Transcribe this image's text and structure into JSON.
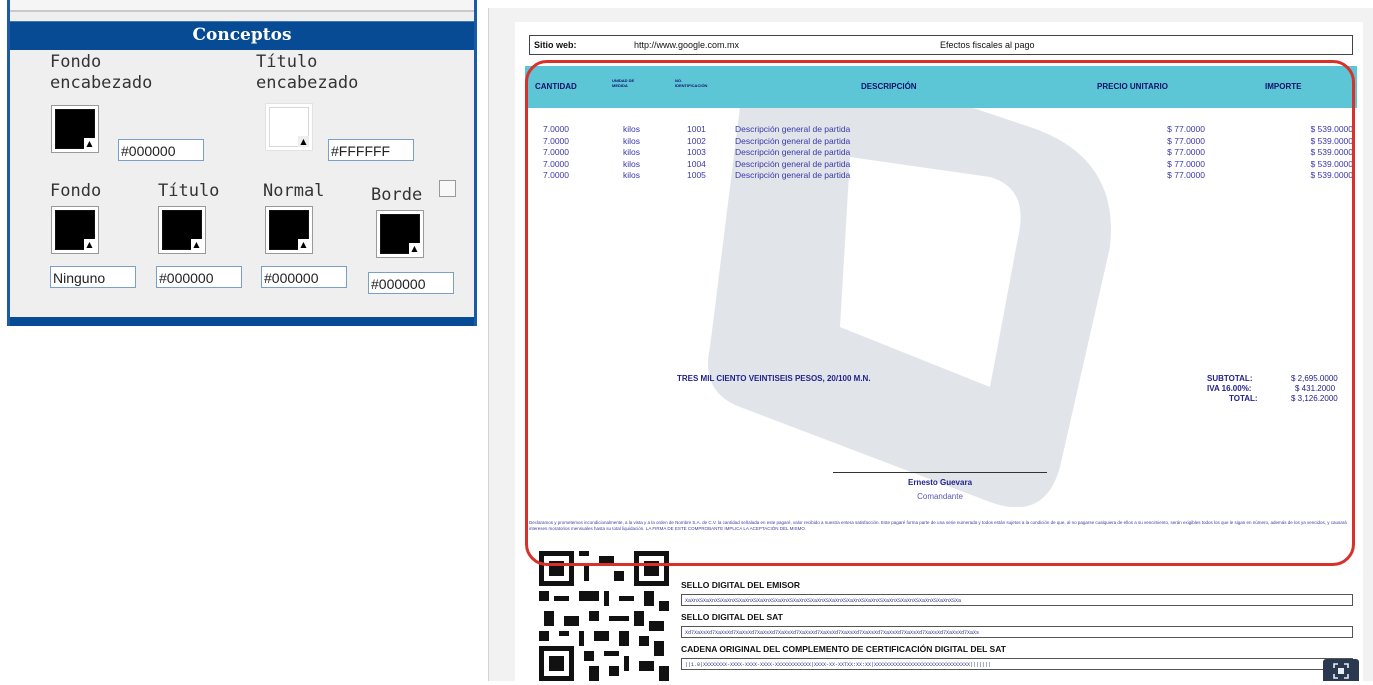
{
  "panel": {
    "header": "Conceptos",
    "fondo_encabezado": {
      "label": "Fondo\nencabezado",
      "value": "#000000",
      "color": "#000000"
    },
    "titulo_encabezado": {
      "label": "Título\nencabezado",
      "value": "#FFFFFF",
      "color": "#FFFFFF"
    },
    "fondo": {
      "label": "Fondo",
      "value": "Ninguno",
      "color": "#000000"
    },
    "titulo": {
      "label": "Título",
      "value": "#000000",
      "color": "#000000"
    },
    "normal": {
      "label": "Normal",
      "value": "#000000",
      "color": "#000000"
    },
    "borde": {
      "label": "Borde",
      "value": "#000000",
      "color": "#000000",
      "checked": false
    }
  },
  "invoice": {
    "site_label": "Sitio web:",
    "site_url": "http://www.google.com.mx",
    "site_note": "Efectos fiscales al pago",
    "columns": {
      "cantidad": "CANTIDAD",
      "unidad": "UNIDAD DE MEDIDA",
      "no": "NO. IDENTIFICACIÓN",
      "descripcion": "DESCRIPCIÓN",
      "precio": "PRECIO UNITARIO",
      "importe": "IMPORTE"
    },
    "rows": [
      {
        "cantidad": "7.0000",
        "unidad": "kilos",
        "no": "1001",
        "descripcion": "Descripción general de partida",
        "precio": "$ 77.0000",
        "importe": "$ 539.0000"
      },
      {
        "cantidad": "7.0000",
        "unidad": "kilos",
        "no": "1002",
        "descripcion": "Descripción general de partida",
        "precio": "$ 77.0000",
        "importe": "$ 539.0000"
      },
      {
        "cantidad": "7.0000",
        "unidad": "kilos",
        "no": "1003",
        "descripcion": "Descripción general de partida",
        "precio": "$ 77.0000",
        "importe": "$ 539.0000"
      },
      {
        "cantidad": "7.0000",
        "unidad": "kilos",
        "no": "1004",
        "descripcion": "Descripción general de partida",
        "precio": "$ 77.0000",
        "importe": "$ 539.0000"
      },
      {
        "cantidad": "7.0000",
        "unidad": "kilos",
        "no": "1005",
        "descripcion": "Descripción general de partida",
        "precio": "$ 77.0000",
        "importe": "$ 539.0000"
      }
    ],
    "amount_words": "TRES MIL CIENTO VEINTISEIS PESOS, 20/100 M.N.",
    "subtotal_label": "SUBTOTAL:",
    "subtotal": "$ 2,695.0000",
    "iva_label": "IVA 16.00%:",
    "iva": "$ 431.2000",
    "total_label": "TOTAL:",
    "total": "$ 3,126.2000",
    "signer_name": "Ernesto Guevara",
    "signer_role": "Comandante",
    "legal_text": "Declaramos y prometemos incondicionalmente, a la vista y a la orden de Nombre S.A. de C.V. la cantidad señalada en este pagaré, valor recibido a nuestra entera satisfacción. Este pagaré forma parte de una serie numerada y todos están sujetos a la condición de que, al no pagarse cualquiera de ellos a su vencimiento, serán exigibles todos los que le sigan en número, además de los ya vencidos, y causará intereses moratorios mensuales hasta su total liquidación. LA FIRMA DE ESTE COMPROBANTE IMPLICA LA ACEPTACIÓN DEL MISMO.",
    "sello_emisor_label": "SELLO DIGITAL DEL EMISOR",
    "sello_emisor": "XaXnXSXaXnXSXaXnXSXaXnXSXaXnXSXaXnXSXaXnXSXaXnXSXaXnXSXaXnXSXaXnXSXaXnXSXaXnXSXaXnXSXaXnXSXa",
    "sello_sat_label": "SELLO DIGITAL DEL SAT",
    "sello_sat": "Xd7XaXsXd7XaXsXd7XaXsXd7XaXsXd7XaXsXd7XaXsXd7XaXsXd7XaXsXd7XaXsXd7XaXsXd7XaXsXd7XaXsXd7XaXsXd7XaXs",
    "cadena_label": "CADENA ORIGINAL DEL COMPLEMENTO DE CERTIFICACIÓN DIGITAL DEL SAT",
    "cadena": "||1.0|XXXXXXXX-XXXX-XXXX-XXXX-XXXXXXXXXXXX|XXXX-XX-XXTXX:XX:XX|XXXXXXXXXXXXXXXXXXXXXXXXXXXXXXXX|||||||"
  }
}
